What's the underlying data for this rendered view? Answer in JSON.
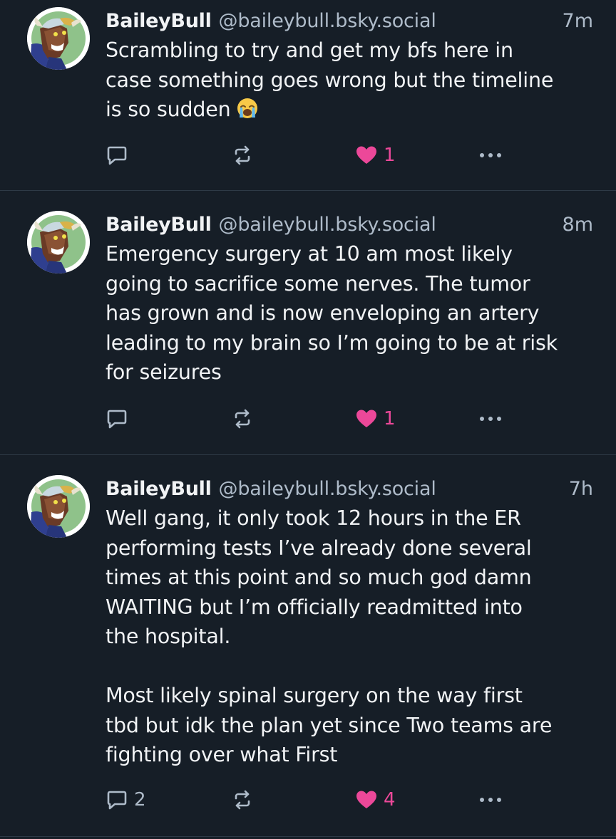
{
  "posts": [
    {
      "author": "BaileyBull",
      "handle": "@baileybull.bsky.social",
      "time": "7m",
      "text": "Scrambling to try and get my bfs here in\ncase something goes wrong but the timeline\nis so sudden",
      "emoji": "loudly-crying-face",
      "reply_count": "",
      "repost_count": "",
      "like_count": "1",
      "liked": true
    },
    {
      "author": "BaileyBull",
      "handle": "@baileybull.bsky.social",
      "time": "8m",
      "text": "Emergency surgery at 10 am most likely\ngoing to sacrifice some nerves. The tumor\nhas grown and is now enveloping an artery\nleading to my brain so I’m going to be at risk\nfor seizures",
      "reply_count": "",
      "repost_count": "",
      "like_count": "1",
      "liked": true
    },
    {
      "author": "BaileyBull",
      "handle": "@baileybull.bsky.social",
      "time": "7h",
      "text": "Well gang, it only took 12 hours in the ER\nperforming tests I’ve already done several\ntimes at this point and so much god damn\nWAITING but I’m officially readmitted into\nthe hospital.\n\nMost likely spinal surgery on the way first\ntbd but idk the plan yet since Two teams are\nfighting over what First",
      "reply_count": "2",
      "repost_count": "",
      "like_count": "4",
      "liked": true
    }
  ],
  "colors": {
    "background": "#161e27",
    "text": "#f1f3f5",
    "muted": "#aebbc9",
    "like": "#ec4899",
    "divider": "#2e3a46"
  }
}
